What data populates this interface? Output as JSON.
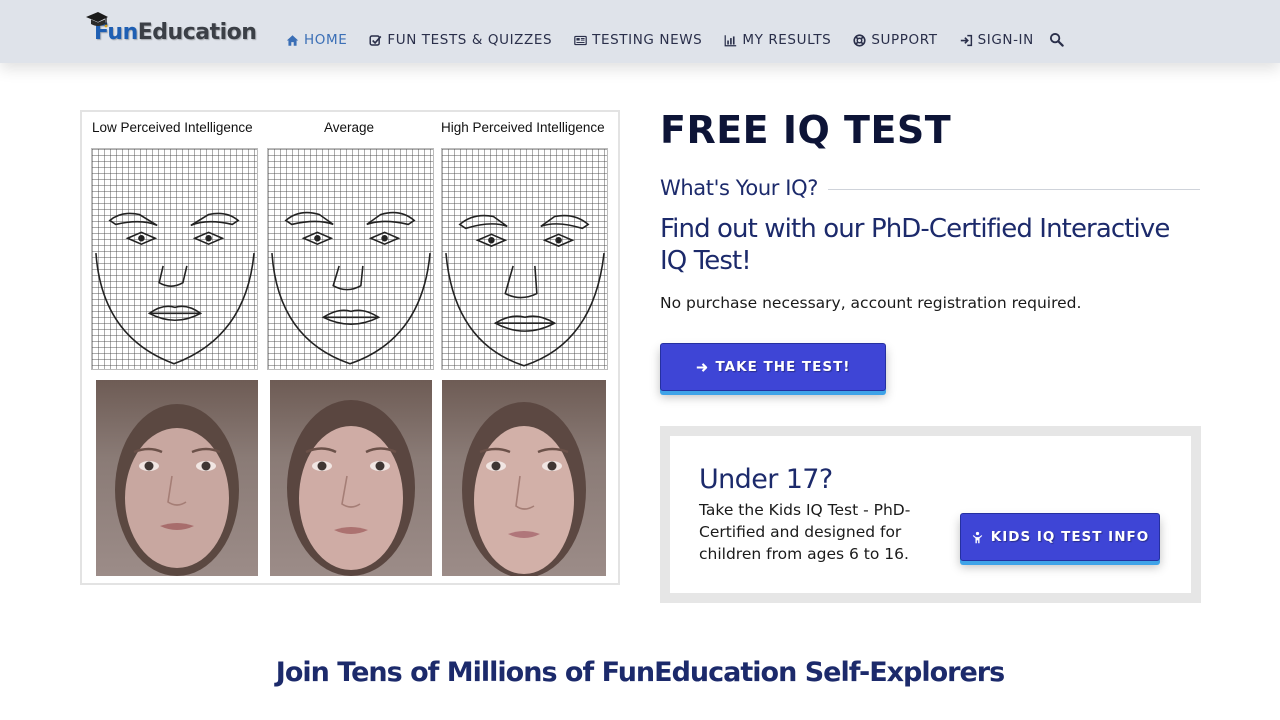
{
  "brand": {
    "name_part1": "Fun",
    "name_part2": "Education",
    "colors": {
      "fun": "#1f5fb3",
      "education": "#3b3f46",
      "cap": "#1b1b1b"
    }
  },
  "nav": {
    "items": [
      {
        "label": "HOME",
        "icon": "home-icon",
        "active": true
      },
      {
        "label": "FUN TESTS & QUIZZES",
        "icon": "check-square-icon"
      },
      {
        "label": "TESTING NEWS",
        "icon": "newspaper-icon"
      },
      {
        "label": "MY RESULTS",
        "icon": "bar-chart-icon"
      },
      {
        "label": "SUPPORT",
        "icon": "life-ring-icon"
      },
      {
        "label": "SIGN-IN",
        "icon": "sign-in-icon"
      }
    ],
    "search_icon": "search-icon"
  },
  "figure": {
    "labels": [
      "Low Perceived Intelligence",
      "Average",
      "High Perceived Intelligence"
    ]
  },
  "hero": {
    "title": "FREE IQ TEST",
    "subtitle": "What's Your IQ?",
    "tagline": "Find out with our PhD-Certified Interactive IQ Test!",
    "note": "No purchase necessary, account registration required.",
    "cta_label": "TAKE THE TEST!",
    "cta_icon": "arrow-right-icon"
  },
  "kids": {
    "title": "Under 17?",
    "description": "Take the Kids IQ Test - PhD-Certified and designed for children from ages 6 to 16.",
    "button_label": "KIDS IQ TEST INFO",
    "button_icon": "child-icon"
  },
  "join_heading": "Join Tens of Millions of FunEducation Self-Explorers",
  "colors": {
    "header_bg": "#dfe3ea",
    "nav_text": "#2a2f4a",
    "nav_active": "#3b6fb6",
    "heading": "#0d1437",
    "subheading": "#1c2a6b",
    "button_bg": "#3e45d6",
    "button_shadow": "#3fa3e8",
    "kids_box_bg": "#e6e6e6"
  }
}
